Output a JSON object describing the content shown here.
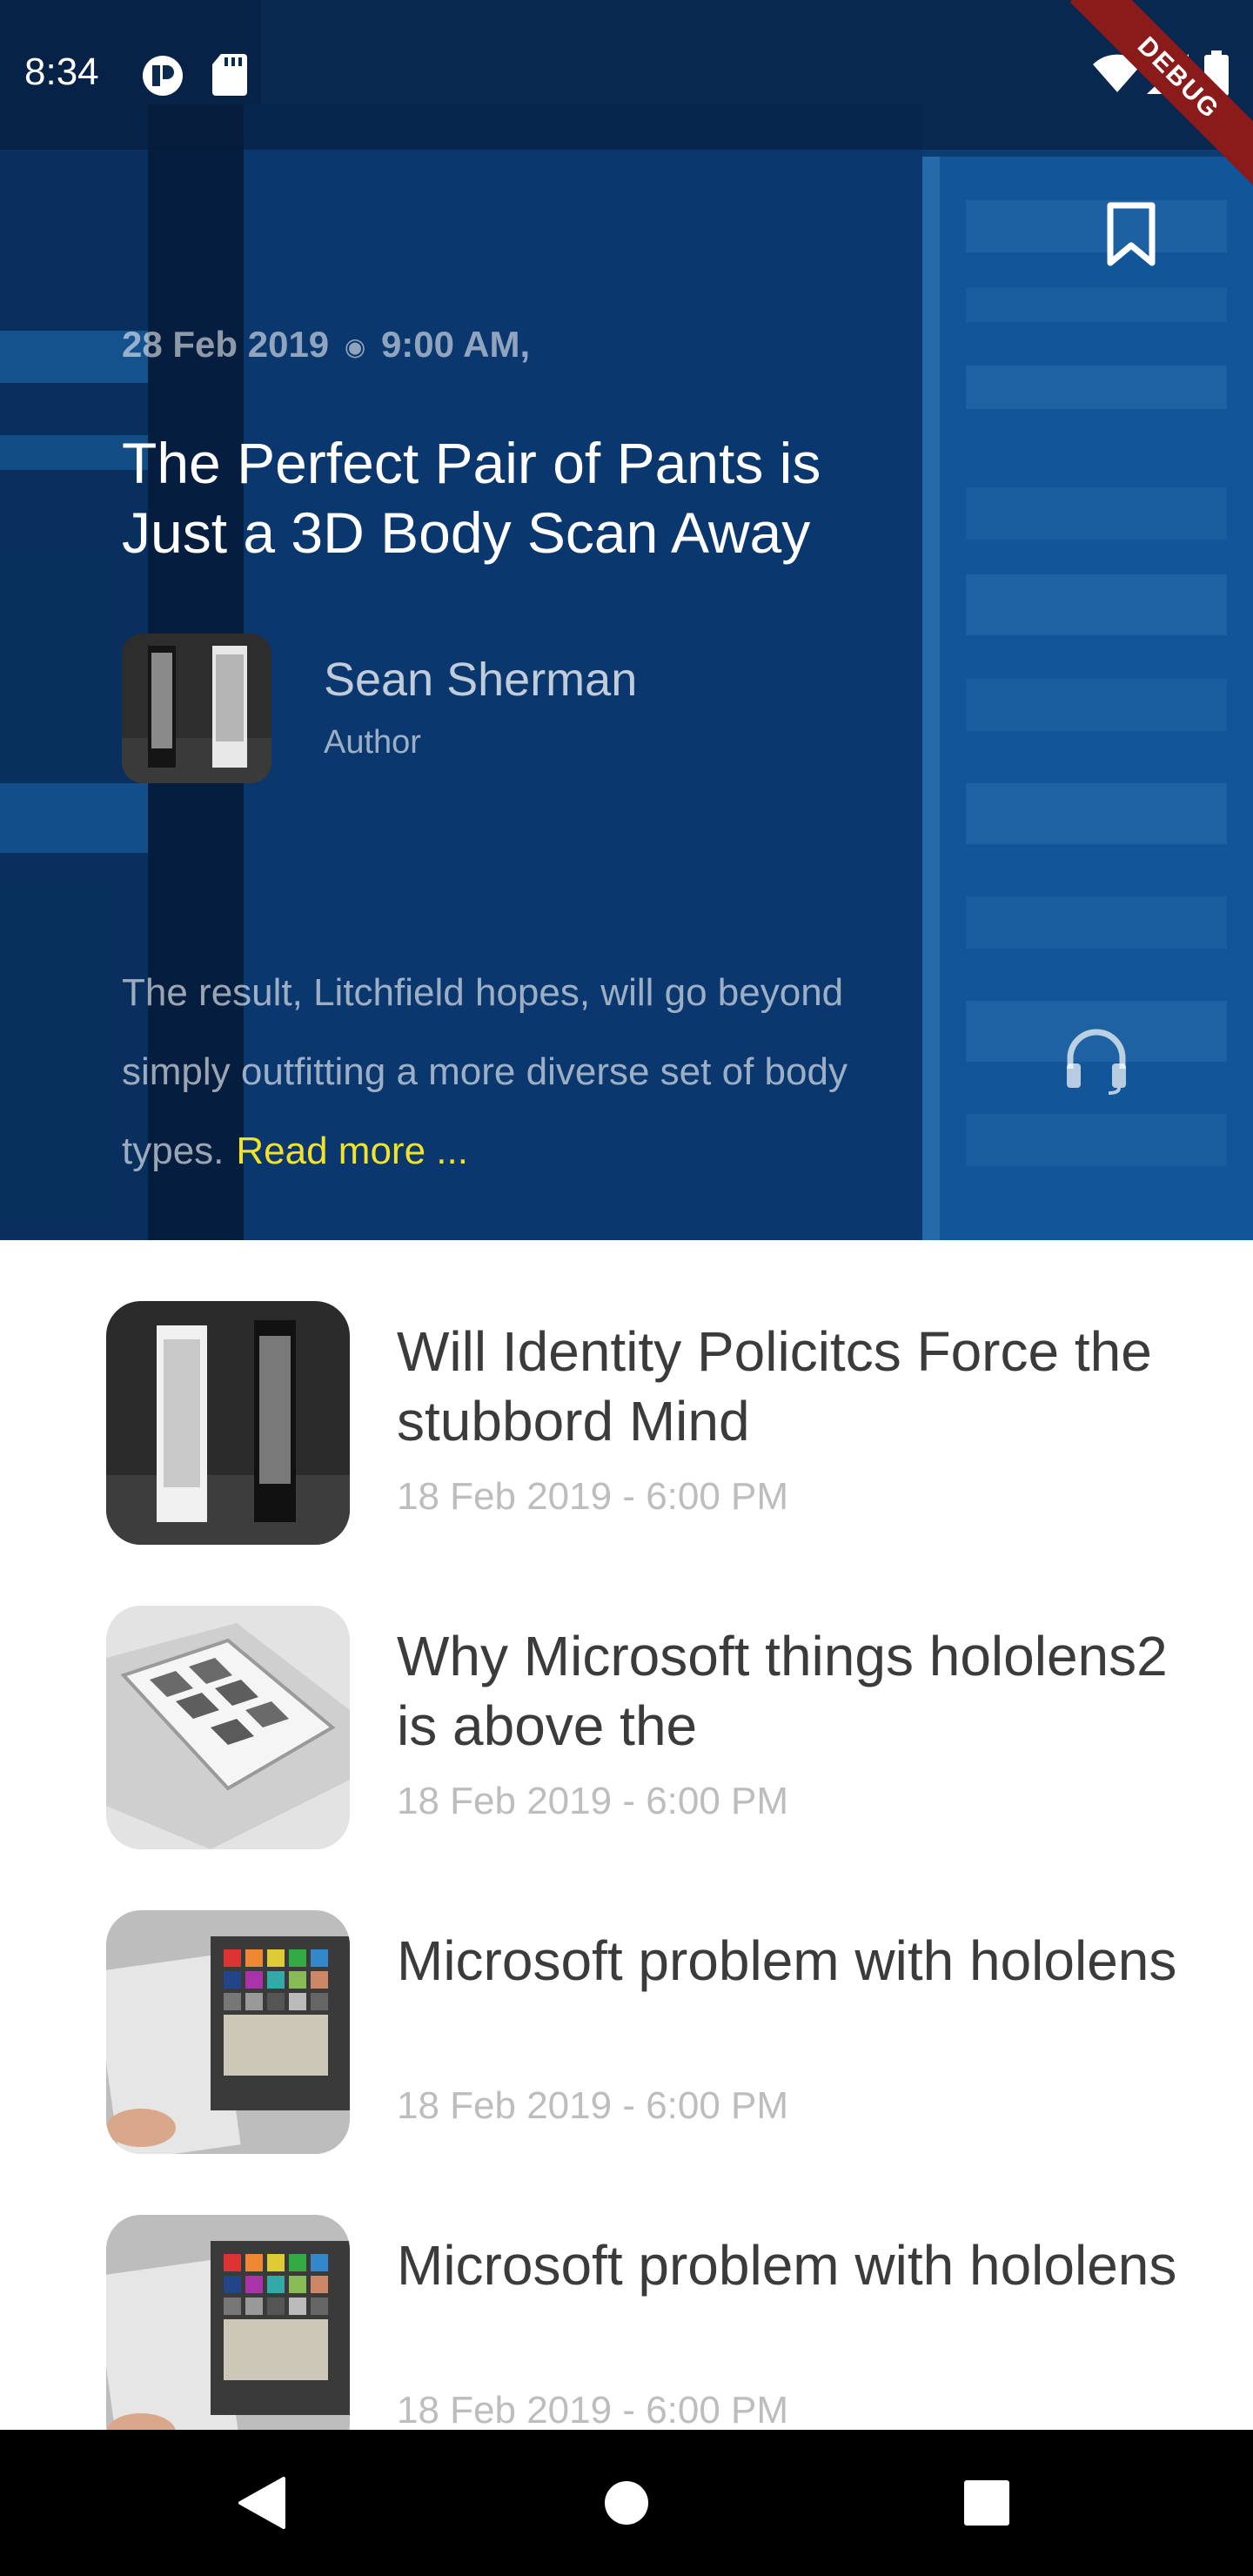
{
  "status_bar": {
    "time": "8:34",
    "icons": [
      "app-notification-icon",
      "sd-card-icon",
      "wifi-icon",
      "signal-icon",
      "battery-icon"
    ]
  },
  "debug_banner": "DEBUG",
  "hero": {
    "date": "28 Feb 2019",
    "time": "9:00 AM,",
    "title": "The Perfect Pair of Pants is Just a 3D Body Scan Away",
    "author_name": "Sean Sherman",
    "author_role": "Author",
    "excerpt": "The result, Litchfield hopes, will go beyond simply outfitting a more diverse set of body types.",
    "read_more": "Read more ...",
    "icons": [
      "bookmark-icon",
      "headset-icon"
    ]
  },
  "articles": [
    {
      "title": "Will Identity Policitcs Force the stubbord Mind",
      "date": "18 Feb 2019 - 6:00 PM",
      "thumbnail": "display-racks-image"
    },
    {
      "title": "Why Microsoft things hololens2 is above the",
      "date": "18 Feb 2019 - 6:00 PM",
      "thumbnail": "sample-tray-image"
    },
    {
      "title": "Microsoft problem with hololens",
      "date": "18 Feb 2019 - 6:00 PM",
      "thumbnail": "color-swatch-binder-image"
    },
    {
      "title": "Microsoft problem with hololens",
      "date": "18 Feb 2019 - 6:00 PM",
      "thumbnail": "color-swatch-binder-image"
    }
  ],
  "nav_bar": {
    "icons": [
      "back-icon",
      "home-icon",
      "recents-icon"
    ]
  },
  "colors": {
    "hero_blue": "#0e4f8c",
    "read_more": "#f2e22a",
    "list_title": "#3b3b3b",
    "list_date": "#bdbdbd"
  }
}
